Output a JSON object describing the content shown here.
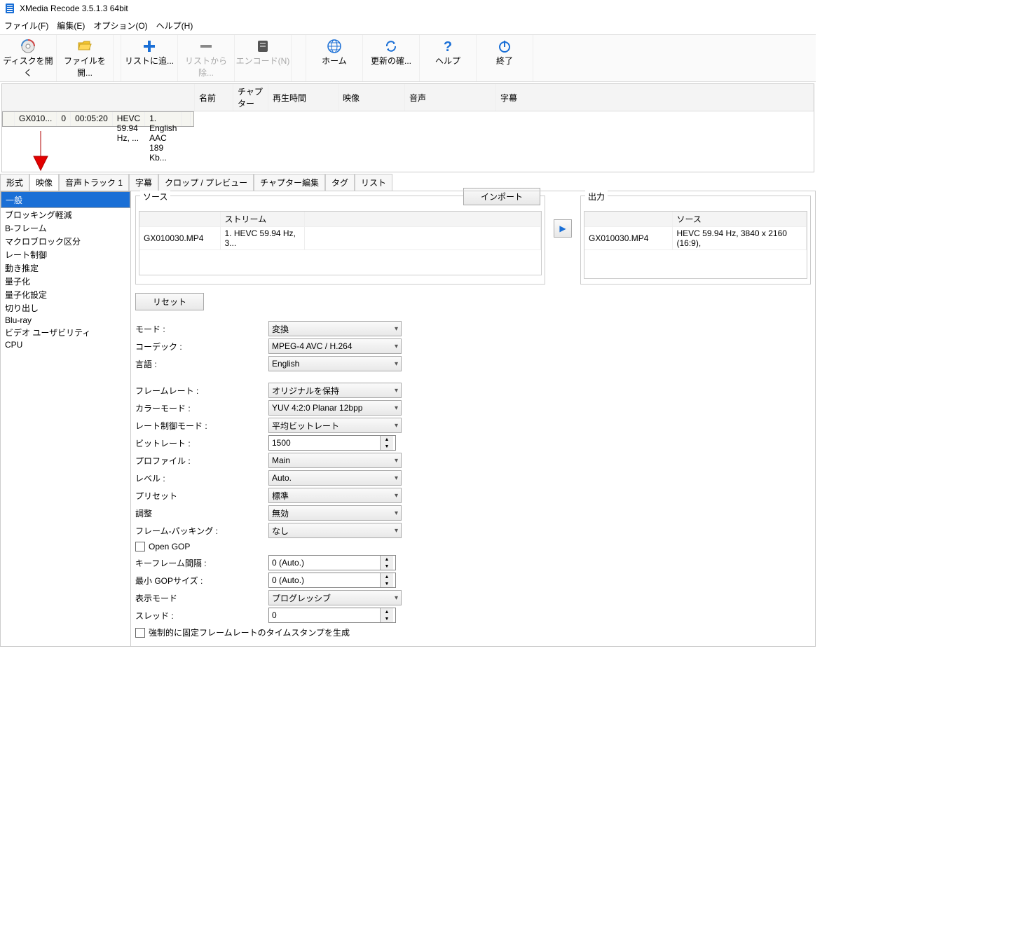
{
  "title": "XMedia Recode 3.5.1.3 64bit",
  "menu": {
    "file": "ファイル(F)",
    "edit": "編集(E)",
    "options": "オプション(O)",
    "help": "ヘルプ(H)"
  },
  "toolbar": {
    "open_disc": "ディスクを開く",
    "open_file": "ファイルを開...",
    "add_list": "リストに追...",
    "remove_list": "リストから除...",
    "encode": "エンコード(N)",
    "home": "ホーム",
    "update": "更新の確...",
    "help": "ヘルプ",
    "exit": "終了"
  },
  "filelist": {
    "cols": {
      "name": "名前",
      "chapter": "チャプター",
      "duration": "再生時間",
      "video": "映像",
      "audio": "音声",
      "sub": "字幕"
    },
    "row": {
      "name": "GX010...",
      "chapter": "0",
      "duration": "00:05:20",
      "video": "HEVC 59.94 Hz, ...",
      "audio": "1. English AAC  189 Kb...",
      "sub": ""
    }
  },
  "tabs": {
    "format": "形式",
    "video": "映像",
    "audio": "音声トラック 1",
    "sub": "字幕",
    "crop": "クロップ / プレビュー",
    "chapter": "チャプター編集",
    "tag": "タグ",
    "list": "リスト"
  },
  "side": [
    "一般",
    "ブロッキング軽減",
    "B-フレーム",
    "マクロブロック区分",
    "レート制御",
    "動き推定",
    "量子化",
    "量子化設定",
    "切り出し",
    "Blu-ray",
    "ビデオ ユーザビリティ",
    "CPU"
  ],
  "source": {
    "label": "ソース",
    "import": "インポート",
    "cols": {
      "file": "",
      "stream": "ストリーム",
      "c3": ""
    },
    "row": {
      "file": "GX010030.MP4",
      "stream": "1. HEVC 59.94 Hz, 3..."
    }
  },
  "output": {
    "label": "出力",
    "cols": {
      "file": "",
      "source": "ソース"
    },
    "row": {
      "file": "GX010030.MP4",
      "source": "HEVC 59.94 Hz, 3840 x 2160 (16:9),"
    }
  },
  "reset": "リセット",
  "form": {
    "mode": {
      "l": "モード :",
      "v": "変換"
    },
    "codec": {
      "l": "コーデック :",
      "v": "MPEG-4 AVC / H.264"
    },
    "lang": {
      "l": "言語 :",
      "v": "English"
    },
    "fps": {
      "l": "フレームレート :",
      "v": "オリジナルを保持"
    },
    "color": {
      "l": "カラーモード :",
      "v": "YUV 4:2:0 Planar 12bpp"
    },
    "rate": {
      "l": "レート制御モード :",
      "v": "平均ビットレート"
    },
    "bitrate": {
      "l": "ビットレート :",
      "v": "1500"
    },
    "profile": {
      "l": "プロファイル :",
      "v": "Main"
    },
    "level": {
      "l": "レベル :",
      "v": "Auto."
    },
    "preset": {
      "l": "プリセット",
      "v": "標準"
    },
    "tune": {
      "l": "調整",
      "v": "無効"
    },
    "packing": {
      "l": "フレーム-パッキング :",
      "v": "なし"
    },
    "opengop": "Open GOP",
    "keyframe": {
      "l": "キーフレーム間隔 :",
      "v": "0 (Auto.)"
    },
    "mingop": {
      "l": "最小 GOPサイズ :",
      "v": "0 (Auto.)"
    },
    "disp": {
      "l": "表示モード",
      "v": "プログレッシブ"
    },
    "thread": {
      "l": "スレッド :",
      "v": "0"
    },
    "force": "強制的に固定フレームレートのタイムスタンプを生成"
  }
}
